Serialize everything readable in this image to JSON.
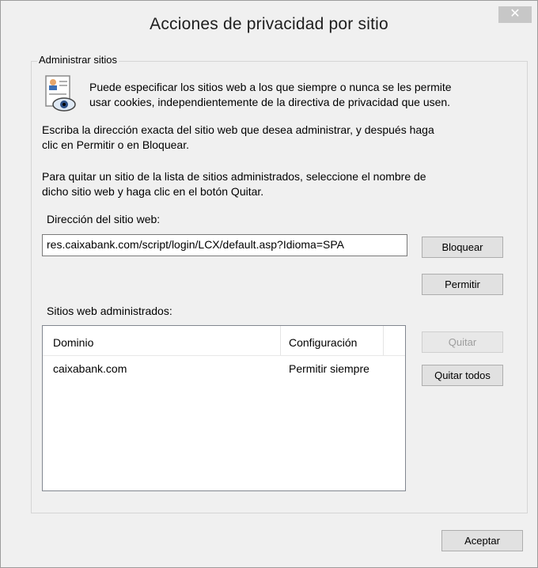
{
  "window": {
    "title": "Acciones de privacidad por sitio",
    "close_glyph": "✕"
  },
  "group": {
    "legend": "Administrar sitios",
    "icon": "privacy-eye-document-icon",
    "intro_line1": "Puede especificar los sitios web a los que siempre o nunca se les permite",
    "intro_line2": "usar cookies, independientemente de la directiva de privacidad que usen.",
    "instr1_line1": "Escriba la dirección exacta del sitio web que desea administrar, y después haga",
    "instr1_line2": "clic en Permitir o en Bloquear.",
    "instr2_line1": "Para quitar un sitio de la lista de sitios administrados, seleccione el nombre de",
    "instr2_line2": "dicho sitio web y haga clic en el botón Quitar.",
    "address_label": "Dirección del sitio web:",
    "address_value": "res.caixabank.com/script/login/LCX/default.asp?Idioma=SPA",
    "block_label": "Bloquear",
    "allow_label": "Permitir",
    "managed_label": "Sitios web administrados:",
    "list": {
      "columns": [
        "Dominio",
        "Configuración"
      ],
      "rows": [
        {
          "domain": "caixabank.com",
          "setting": "Permitir siempre"
        }
      ]
    },
    "remove_label": "Quitar",
    "remove_all_label": "Quitar todos"
  },
  "footer": {
    "ok_label": "Aceptar"
  }
}
